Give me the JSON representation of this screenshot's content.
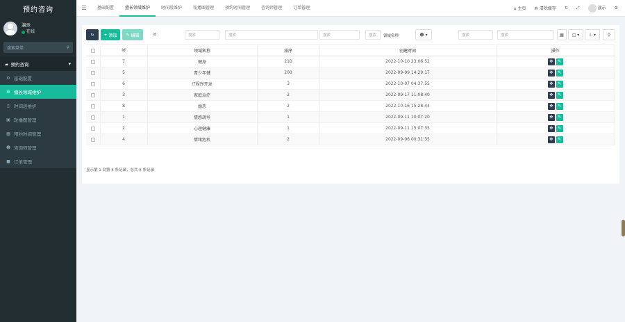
{
  "app": {
    "title": "预约咨询"
  },
  "user": {
    "name": "演示",
    "status": "在线"
  },
  "sidebar": {
    "search_placeholder": "搜索菜单",
    "group": "预约咨询",
    "items": [
      {
        "label": "基础配置",
        "icon": "gear-icon"
      },
      {
        "label": "擅长领域维护",
        "icon": "list-icon",
        "active": true
      },
      {
        "label": "时间段维护",
        "icon": "clock-icon"
      },
      {
        "label": "轮播图管理",
        "icon": "image-icon"
      },
      {
        "label": "预约时间管理",
        "icon": "calendar-icon"
      },
      {
        "label": "咨询师管理",
        "icon": "user-icon"
      },
      {
        "label": "订单管理",
        "icon": "order-icon"
      }
    ]
  },
  "topbar": {
    "tabs": [
      "基础配置",
      "擅长领域维护",
      "时间段维护",
      "轮播图管理",
      "预约时间管理",
      "咨询师管理",
      "订单管理"
    ],
    "home": "主页",
    "clear_cache": "清除缓存",
    "user": "演示"
  },
  "toolbar": {
    "add": "添加",
    "edit": "编辑",
    "id_label": "Id",
    "placeholder": "搜索",
    "field_label": "领域名称",
    "search_placeholder": "搜索"
  },
  "table": {
    "headers": [
      "Id",
      "领域名称",
      "排序",
      "创建时间",
      "操作"
    ],
    "rows": [
      {
        "id": "7",
        "name": "健身",
        "sort": "210",
        "time": "2022-10-10 23:06:52"
      },
      {
        "id": "5",
        "name": "青少年健",
        "sort": "200",
        "time": "2022-09-09 14:29:17"
      },
      {
        "id": "6",
        "name": "IT程序开发",
        "sort": "3",
        "time": "2022-10-07 04:37:55"
      },
      {
        "id": "3",
        "name": "家庭治疗",
        "sort": "2",
        "time": "2022-09-17 11:08:40"
      },
      {
        "id": "8",
        "name": "婚恋",
        "sort": "2",
        "time": "2022-10-16 15:28:44"
      },
      {
        "id": "1",
        "name": "情感疏导",
        "sort": "1",
        "time": "2022-09-11 10:07:20"
      },
      {
        "id": "2",
        "name": "心理健康",
        "sort": "1",
        "time": "2022-09-11 15:07:35"
      },
      {
        "id": "4",
        "name": "情绪危机",
        "sort": "2",
        "time": "2022-09-06 00:31:35"
      }
    ]
  },
  "pager": {
    "text": "显示第 1 到第 8 条记录，总共 8 条记录"
  },
  "colors": {
    "accent": "#18bc9c",
    "sidebar": "#222d32",
    "dark_button": "#2c3e50"
  }
}
